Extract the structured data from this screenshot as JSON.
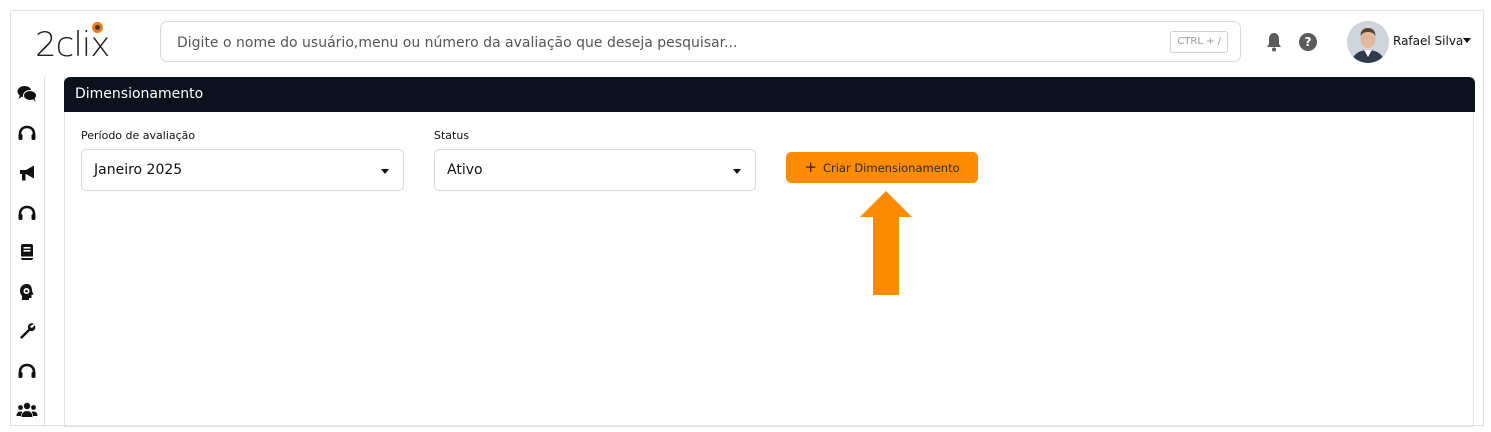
{
  "app": {
    "logo_text": "2clix"
  },
  "search": {
    "placeholder": "Digite o nome do usuário,menu ou número da avaliação que deseja pesquisar...",
    "shortcut": "CTRL + /"
  },
  "header": {
    "help_label": "?",
    "user_name": "Rafael Silva"
  },
  "sidebar": {
    "icons": [
      "comments-icon",
      "headphones-icon",
      "megaphone-icon",
      "headphones-icon",
      "book-icon",
      "head-gear-icon",
      "wrench-icon",
      "headphones-icon",
      "users-icon"
    ]
  },
  "panel": {
    "title": "Dimensionamento",
    "period_label": "Período de avaliação",
    "period_value": "Janeiro 2025",
    "status_label": "Status",
    "status_value": "Ativo",
    "create_label": "Criar Dimensionamento"
  },
  "colors": {
    "accent": "#ff8c00",
    "header_bg": "#0b111d",
    "logo_dot": "#f07a1a"
  }
}
